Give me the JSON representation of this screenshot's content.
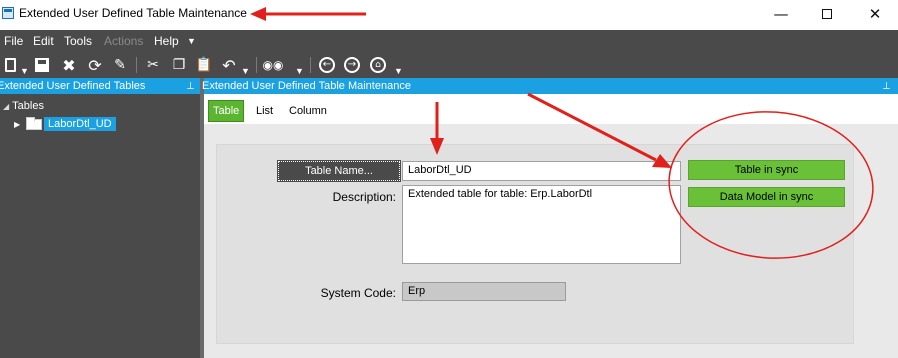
{
  "window": {
    "title": "Extended User Defined Table Maintenance",
    "minimize_icon": "minimize-icon",
    "maximize_icon": "maximize-icon",
    "close_icon": "close-icon"
  },
  "menu": {
    "items": [
      {
        "label": "File",
        "enabled": true
      },
      {
        "label": "Edit",
        "enabled": true
      },
      {
        "label": "Tools",
        "enabled": true
      },
      {
        "label": "Actions",
        "enabled": false
      },
      {
        "label": "Help",
        "enabled": true
      }
    ]
  },
  "toolbar": {
    "icons": [
      "new-icon",
      "save-icon",
      "delete-icon",
      "refresh-icon",
      "clear-icon",
      "cut-icon",
      "copy-icon",
      "paste-icon",
      "undo-icon",
      "binoculars-icon",
      "back-icon",
      "forward-icon",
      "home-icon"
    ]
  },
  "left_panel": {
    "header": "Extended User Defined Tables",
    "tree": {
      "root_label": "Tables",
      "child_label": "LaborDtl_UD"
    }
  },
  "main_panel": {
    "header": "Extended User Defined Table Maintenance",
    "tabs": [
      {
        "label": "Table",
        "active": true
      },
      {
        "label": "List",
        "active": false
      },
      {
        "label": "Column",
        "active": false
      }
    ],
    "form": {
      "table_name_button": "Table Name...",
      "table_name_value": "LaborDtl_UD",
      "description_label": "Description:",
      "description_value": "Extended table for table: Erp.LaborDtl",
      "system_code_label": "System Code:",
      "system_code_value": "Erp",
      "table_sync_status": "Table in sync",
      "model_sync_status": "Data Model in sync"
    }
  },
  "colors": {
    "header_blue": "#1ba1e2",
    "dark_chrome": "#4a4a4a",
    "sync_green": "#6ac137",
    "annotation_red": "#e0201b"
  }
}
